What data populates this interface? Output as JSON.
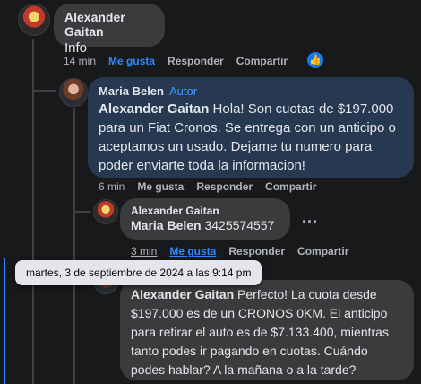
{
  "comment1": {
    "author": "Alexander Gaitan",
    "text": "Info",
    "time": "14 min",
    "like": "Me gusta",
    "reply": "Responder",
    "share": "Compartir",
    "reaction_icon": "thumbs-up-icon"
  },
  "comment2": {
    "author": "Maria Belen",
    "badge": "Autor",
    "mention": "Alexander Gaitan",
    "text": " Hola! Son cuotas de $197.000 para un Fiat Cronos. Se entrega con un anticipo o aceptamos un usado. Dejame tu numero para poder enviarte toda la informacion!",
    "time": "6 min",
    "like": "Me gusta",
    "reply": "Responder",
    "share": "Compartir"
  },
  "comment3": {
    "author": "Alexander Gaitan",
    "mention": "Maria Belen",
    "text": " 3425574557",
    "time": "3 min",
    "like": "Me gusta",
    "reply": "Responder",
    "share": "Compartir",
    "more": "..."
  },
  "comment4": {
    "mention": "Alexander Gaitan",
    "text": " Perfecto! La cuota desde $197.000 es de un CRONOS 0KM. El anticipo para retirar el auto es de $7.133.400, mientras tanto podes ir pagando en cuotas. Cuándo podes hablar? A la mañana o a la tarde?"
  },
  "tooltip": {
    "text": "martes, 3 de septiembre de 2024 a las 9:14 pm"
  },
  "colors": {
    "background": "#18191a",
    "bubble": "#3a3b3c",
    "highlight_bubble": "#263951",
    "accent": "#2d88ff"
  }
}
